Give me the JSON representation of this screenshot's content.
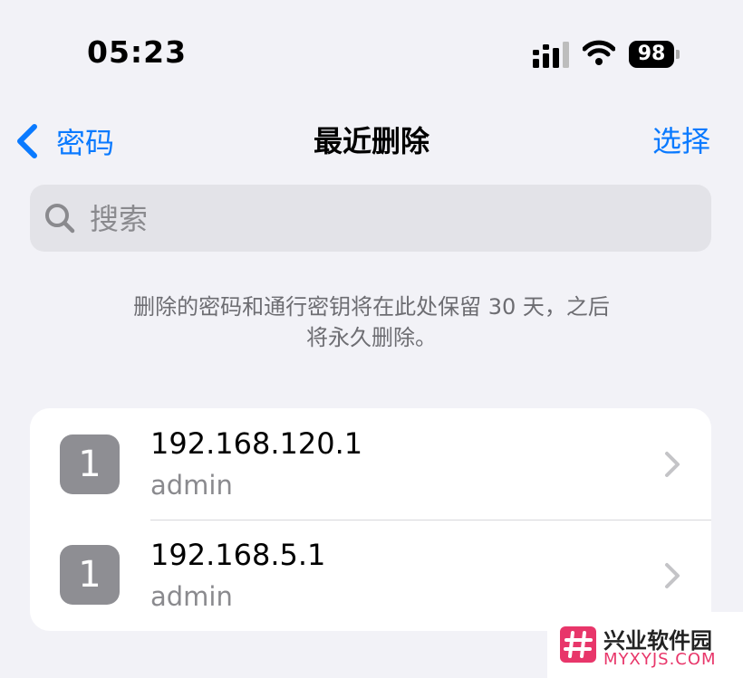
{
  "status_bar": {
    "time": "05:23",
    "battery": "98"
  },
  "nav": {
    "back_label": "密码",
    "title": "最近删除",
    "select_label": "选择"
  },
  "search": {
    "placeholder": "搜索"
  },
  "info": {
    "line1": "删除的密码和通行密钥将在此处保留 30 天，之后",
    "line2": "将永久删除。"
  },
  "items": [
    {
      "icon_letter": "1",
      "title": "192.168.120.1",
      "subtitle": "admin"
    },
    {
      "icon_letter": "1",
      "title": "192.168.5.1",
      "subtitle": "admin"
    }
  ],
  "watermark": {
    "name": "兴业软件园",
    "site": "MYXYJS.COM"
  },
  "colors": {
    "accent": "#0a7aff",
    "background": "#f2f2f7",
    "icon_bg": "#8e8e93",
    "watermark_pink": "#e8366a"
  },
  "icons": [
    "signal-icon",
    "wifi-icon",
    "battery-icon",
    "chevron-left-icon",
    "search-icon",
    "chevron-right-icon"
  ]
}
